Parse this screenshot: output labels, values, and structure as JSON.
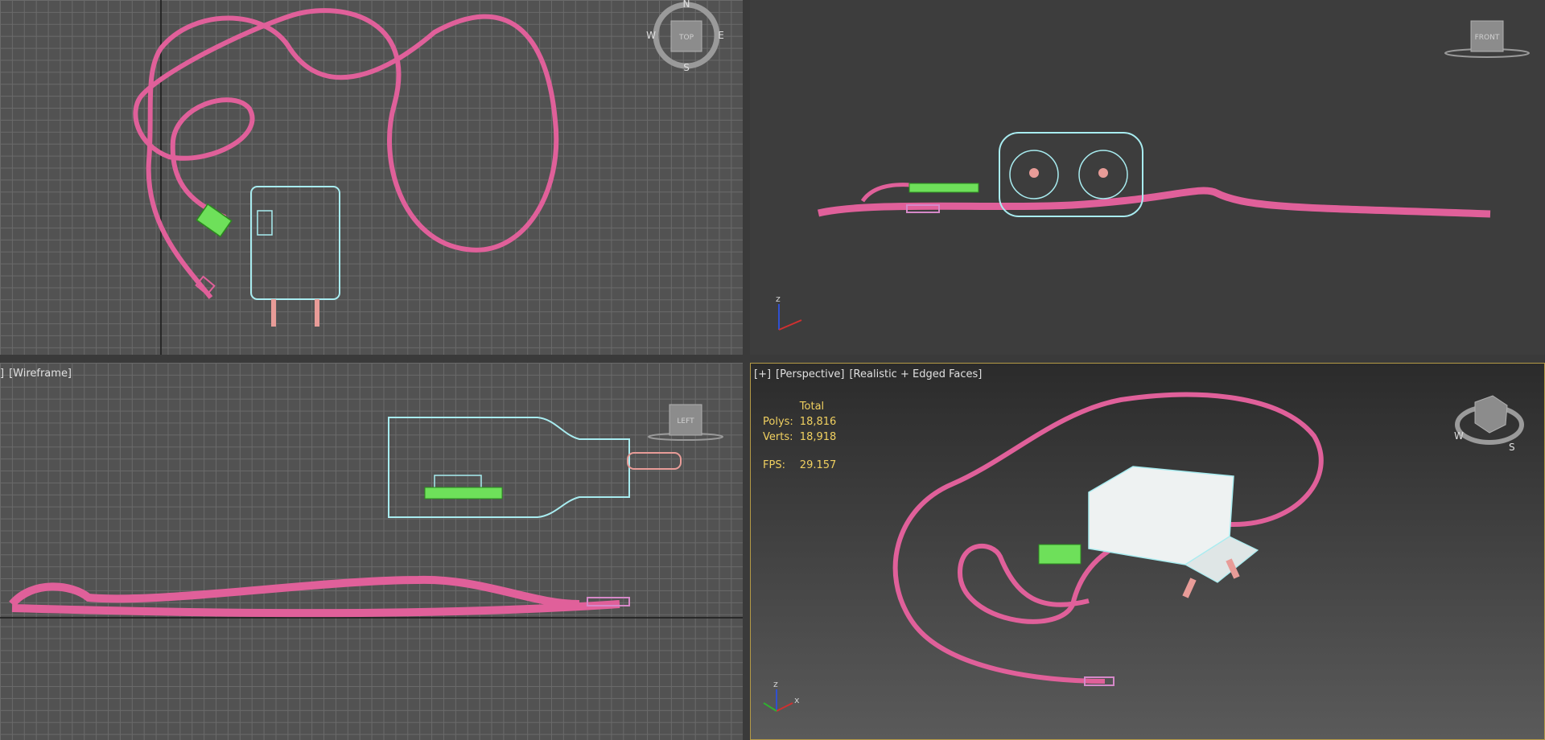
{
  "viewports": {
    "top": {
      "cube_label": "TOP",
      "compass": {
        "n": "N",
        "s": "S",
        "e": "E",
        "w": "W"
      }
    },
    "front": {
      "cube_label": "FRONT",
      "axis": {
        "z": "z"
      }
    },
    "left": {
      "label_1": "]",
      "label_2": "[Wireframe]",
      "cube_label": "LEFT"
    },
    "perspective": {
      "label_1": "[+]",
      "label_2": "[Perspective]",
      "label_3": "[Realistic + Edged Faces]",
      "stats": {
        "header": "Total",
        "polys_label": "Polys:",
        "polys_value": "18,816",
        "verts_label": "Verts:",
        "verts_value": "18,918",
        "fps_label": "FPS:",
        "fps_value": "29.157"
      },
      "compass": {
        "w": "W",
        "s": "S"
      },
      "axis": {
        "z": "z",
        "x": "x"
      }
    }
  },
  "colors": {
    "cable": "#e0609a",
    "charger": "#a8ecf0",
    "connector": "#6ee05a",
    "prongs": "#e89c98",
    "viewport_active_border": "#b59a46",
    "stats_text": "#f0d060"
  }
}
